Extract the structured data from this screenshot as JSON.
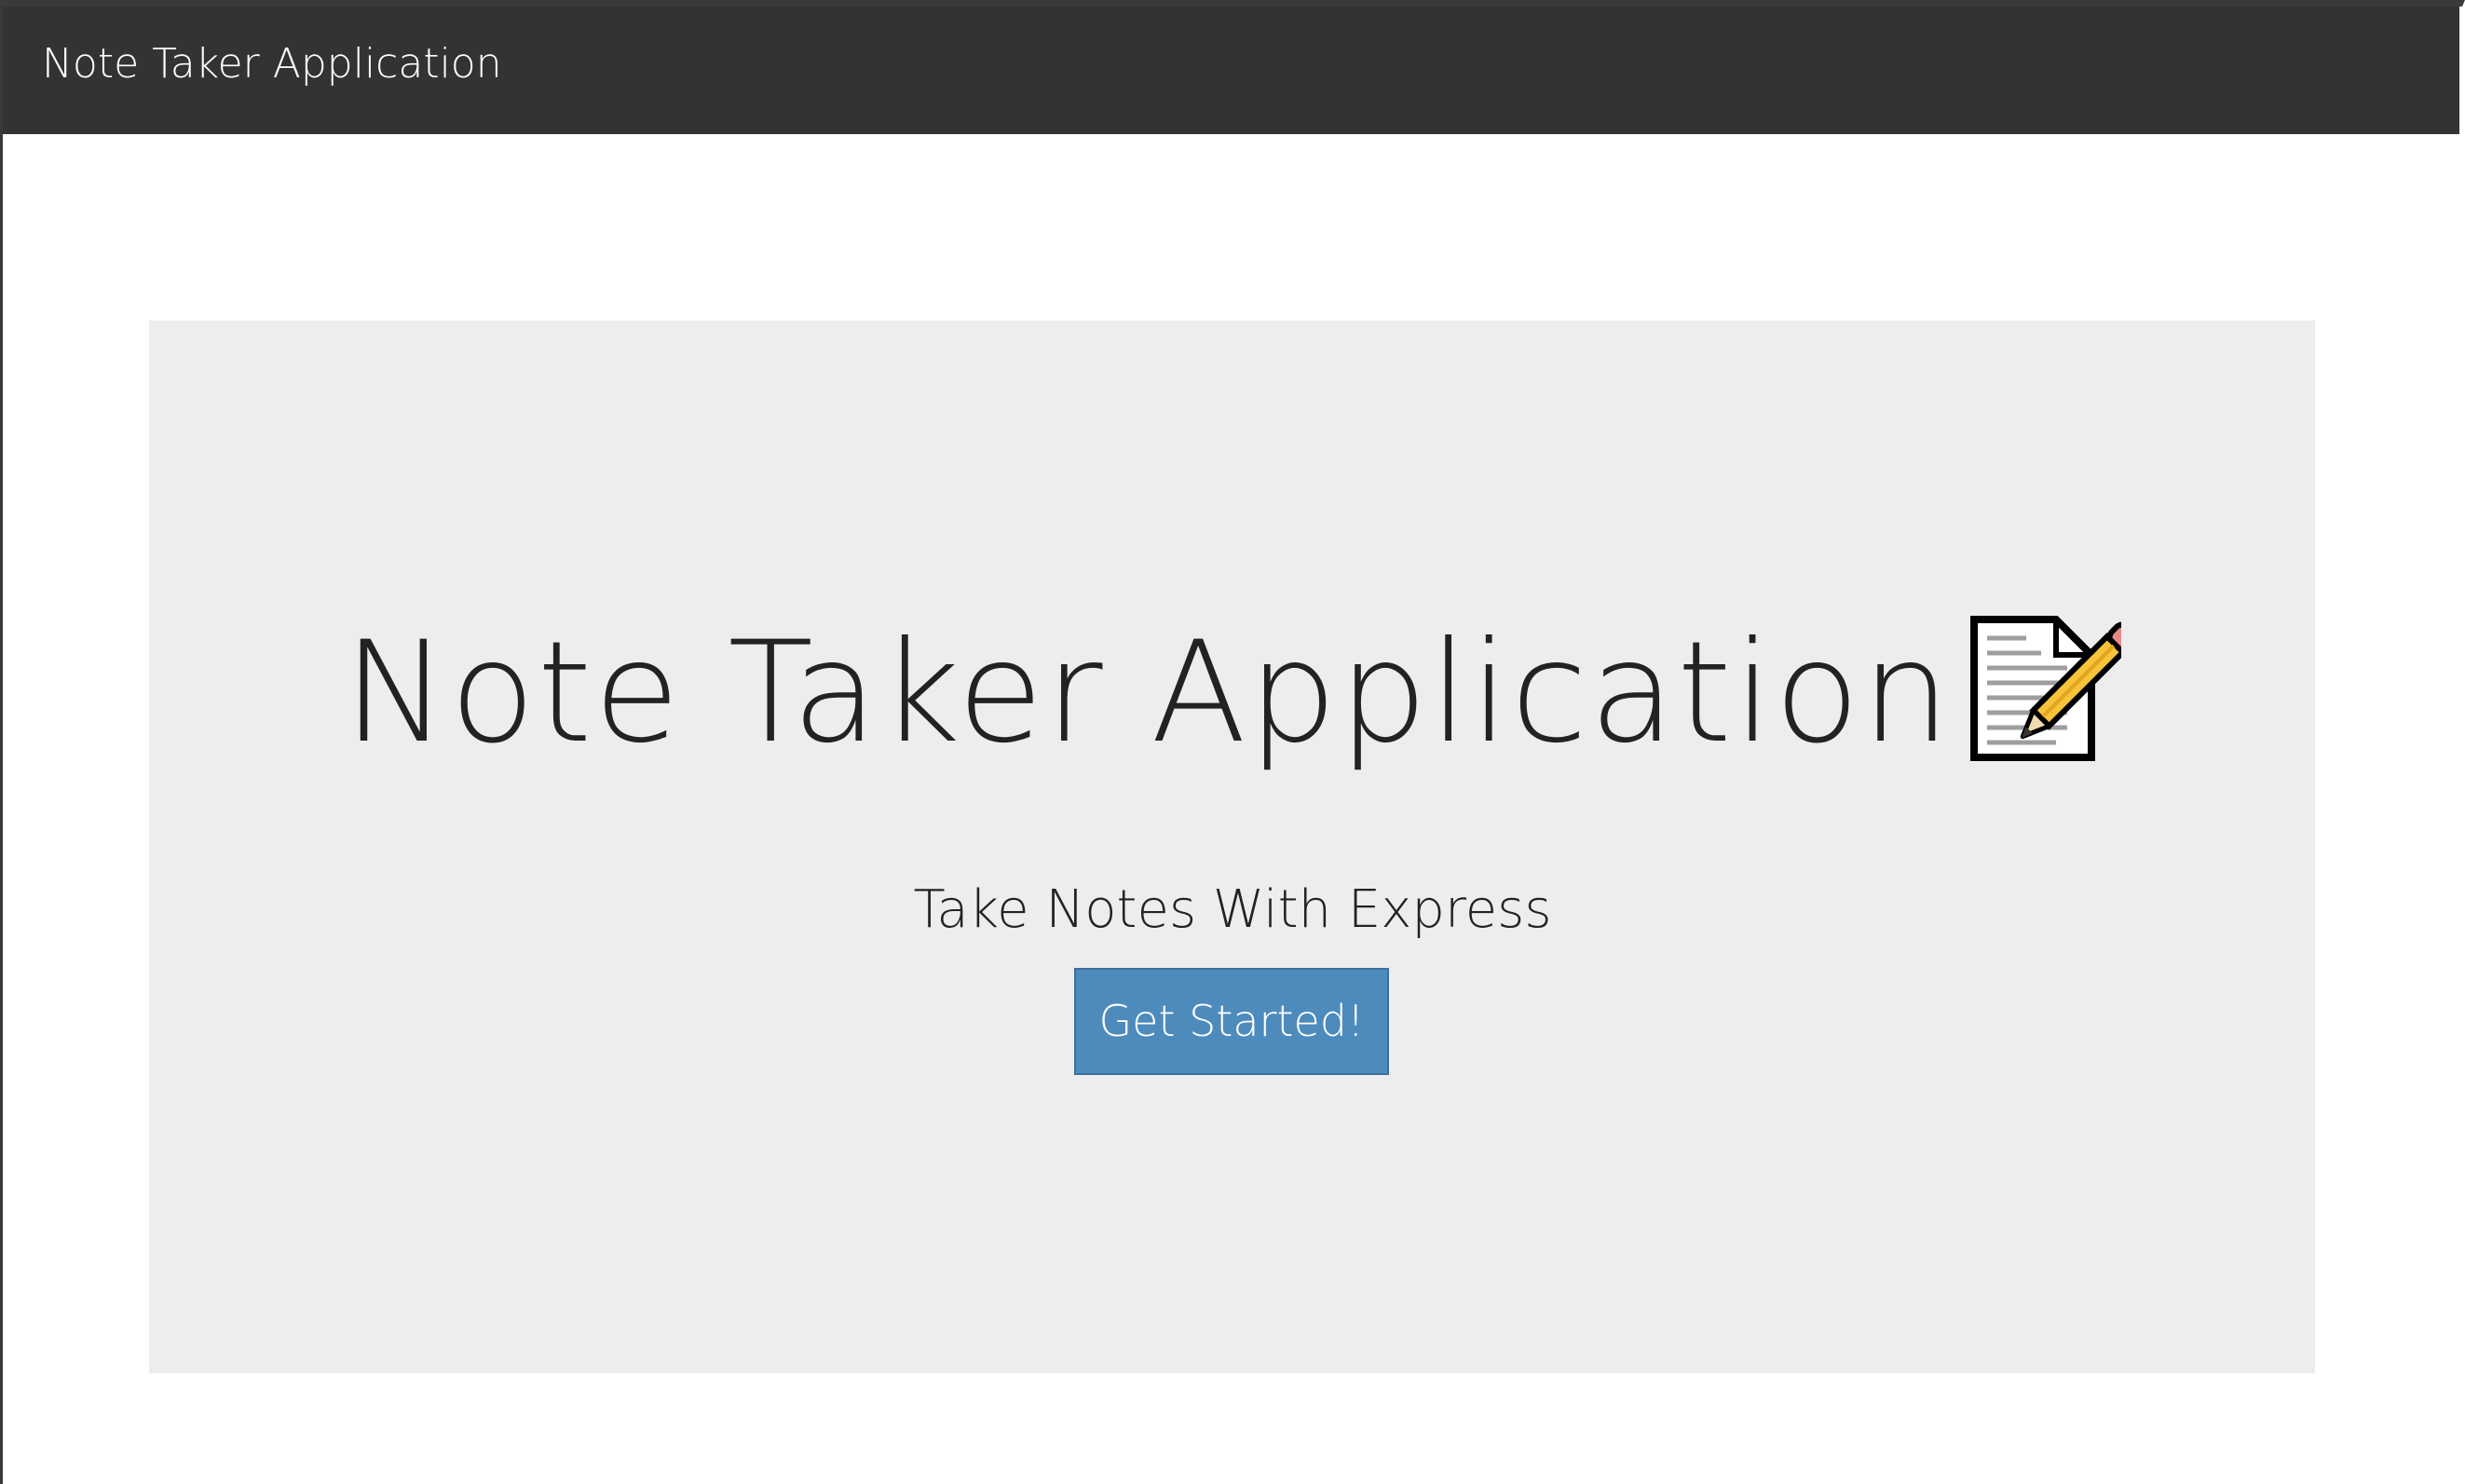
{
  "navbar": {
    "brand": "Note Taker Application",
    "background": "#333333"
  },
  "hero": {
    "title": "Note Taker Application",
    "title_icon": "memo-icon",
    "subtitle": "Take Notes With Express",
    "background": "#ededed"
  },
  "actions": {
    "get_started_label": "Get Started!",
    "button_color": "#4e8bbd"
  }
}
